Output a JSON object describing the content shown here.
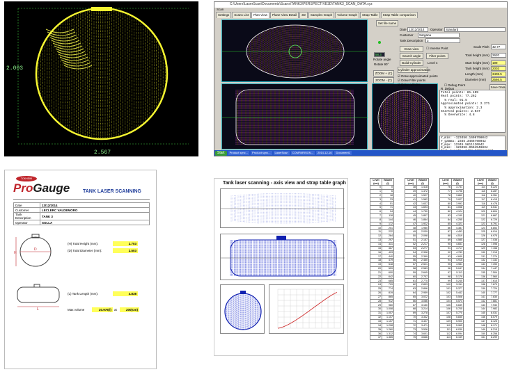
{
  "scan_view": {
    "height_label": "2.003",
    "width_label": "2.567"
  },
  "software": {
    "window_title": "C:\\Users\\LaserScan\\Documents\\Scans\\TANK3\\PERSPECTIVE3D\\TANK3_SCAN_DATA.xyz",
    "menu": "Scan",
    "tabs": [
      "Settings",
      "Scans List",
      "Plan View",
      "Plane View Detail",
      "3D",
      "Samples Graph",
      "Volume Graph",
      "Strap Table",
      "Strap Table comparison"
    ],
    "active_tab_index": 2,
    "buttons": {
      "set_file_name": "Set file name",
      "draw_view": "Draw view",
      "search_angle": "Search angle",
      "filter_points": "Filter points",
      "build_cylinder": "Build Cylinder",
      "cylinder_approximation": "Cylinder approximation",
      "zoom_plus": "ZOOM + (C)",
      "zoom_minus": "ZOOM - (C)",
      "save_data": "Save Data",
      "rotate_angle": "Rotate angle",
      "rotate": "Rotate 90°"
    },
    "fields": {
      "date_label": "Date",
      "date_value": "13/12/2014",
      "operator_label": "Operator",
      "operator_value": "Standard",
      "customer_label": "Customer",
      "customer_value": "Sargana",
      "tank_desc_label": "Tank Description",
      "tank_desc_value": "3",
      "scale_pitch_label": "Scale Pitch",
      "scale_pitch_value": "42.77",
      "total_height_label": "Total height (mm)",
      "total_height_value": "2620",
      "start_height_label": "Start height (mm)",
      "start_height_value": "199",
      "tank_height_label": "Tank height (mm)",
      "tank_height_value": "2003",
      "length_label": "Length (mm)",
      "length_value": "3408.5",
      "diameter_label": "Diameter (mm)",
      "diameter_value": "2566.5",
      "level_label": "Level 4",
      "angle_value": "58.3"
    },
    "checkboxes": {
      "inverse_point": "Inverse Point",
      "draw_approx": "Draw approximated points",
      "draw_filter": "Draw Filter points",
      "draw_cylinder": "Draw cylinder",
      "debug": "Debug Point",
      "debug2": "R_Debug"
    },
    "stats_text": "Total points: 81.409\nReal points: 77.262\n  % real: 91.5\nApproximated points: 2.271\n  % approximation: 2.3\nStarted points: 2.047\n  % Overwrite: 4.8",
    "stats2_text": "Y_min: -123456.1606798042\nY_gamma: 2345.3466798042\nZ_max: 12345.5611120942\nX_min: -123456.9564546834\nTank_length: 3408.5795641334",
    "taskbar": [
      "Start",
      "Product sync...",
      "Product sync...",
      "LaserScan",
      "COMPARISON...",
      "2014-12-16",
      "Document1"
    ]
  },
  "report": {
    "logo_badge": "TOKHEIM",
    "logo_pro": "Pro",
    "logo_gauge": "Gauge",
    "title": "TANK LASER SCANNING",
    "info": [
      {
        "k": "Date",
        "v": "13/12/2014"
      },
      {
        "k": "Customer",
        "v": "LECLERC VALDEMORO"
      },
      {
        "k": "Tank Description",
        "v": "TANK 3"
      },
      {
        "k": "Operator",
        "v": "SOLLA"
      }
    ],
    "meas": [
      {
        "label": "(H) Total Height (mm):",
        "value": "2.703"
      },
      {
        "label": "(D) Total Diameter (mm):",
        "value": "2.503"
      },
      {
        "label": "(L) Tank Length (mm):",
        "value": "4.838"
      }
    ],
    "max_volume_label": "Max volume",
    "max_volume_value": "20.976(l)",
    "max_volume_at": "at",
    "max_volume_mm": "200(cm)",
    "dim_h": "H",
    "dim_d": "D",
    "dim_l": "L"
  },
  "axis_view": {
    "title": "Tank laser scanning - axis view and strap table graph"
  },
  "strap_table": {
    "headers": [
      "Level (cm)",
      "Volume (l)"
    ],
    "columns": [
      [
        [
          "0",
          "0"
        ],
        [
          "1",
          "6"
        ],
        [
          "2",
          "18"
        ],
        [
          "3",
          "33"
        ],
        [
          "4",
          "51"
        ],
        [
          "5",
          "71"
        ],
        [
          "6",
          "94"
        ],
        [
          "7",
          "118"
        ],
        [
          "8",
          "144"
        ],
        [
          "9",
          "172"
        ],
        [
          "10",
          "201"
        ],
        [
          "11",
          "232"
        ],
        [
          "12",
          "264"
        ],
        [
          "13",
          "297"
        ],
        [
          "14",
          "331"
        ],
        [
          "15",
          "367"
        ],
        [
          "16",
          "403"
        ],
        [
          "17",
          "440"
        ],
        [
          "18",
          "479"
        ],
        [
          "19",
          "518"
        ],
        [
          "20",
          "559"
        ],
        [
          "21",
          "600"
        ],
        [
          "22",
          "642"
        ],
        [
          "23",
          "685"
        ],
        [
          "24",
          "729"
        ],
        [
          "25",
          "774"
        ],
        [
          "26",
          "819"
        ],
        [
          "27",
          "865"
        ],
        [
          "28",
          "912"
        ],
        [
          "29",
          "960"
        ],
        [
          "30",
          "1.008"
        ],
        [
          "31",
          "1.057"
        ],
        [
          "32",
          "1.107"
        ],
        [
          "33",
          "1.157"
        ],
        [
          "34",
          "1.208"
        ],
        [
          "35",
          "1.260"
        ],
        [
          "36",
          "1.312"
        ],
        [
          "37",
          "1.365"
        ]
      ],
      [
        [
          "38",
          "1.418"
        ],
        [
          "39",
          "1.472"
        ],
        [
          "40",
          "1.527"
        ],
        [
          "41",
          "1.582"
        ],
        [
          "42",
          "1.637"
        ],
        [
          "43",
          "1.693"
        ],
        [
          "44",
          "1.750"
        ],
        [
          "45",
          "1.807"
        ],
        [
          "46",
          "1.864"
        ],
        [
          "47",
          "1.922"
        ],
        [
          "48",
          "1.980"
        ],
        [
          "49",
          "2.039"
        ],
        [
          "50",
          "2.098"
        ],
        [
          "51",
          "2.157"
        ],
        [
          "52",
          "2.217"
        ],
        [
          "53",
          "2.277"
        ],
        [
          "54",
          "2.338"
        ],
        [
          "55",
          "2.399"
        ],
        [
          "56",
          "2.460"
        ],
        [
          "57",
          "2.521"
        ],
        [
          "58",
          "2.583"
        ],
        [
          "59",
          "2.645"
        ],
        [
          "60",
          "2.707"
        ],
        [
          "61",
          "2.770"
        ],
        [
          "62",
          "2.833"
        ],
        [
          "63",
          "2.896"
        ],
        [
          "64",
          "2.959"
        ],
        [
          "65",
          "3.022"
        ],
        [
          "66",
          "3.086"
        ],
        [
          "67",
          "3.150"
        ],
        [
          "68",
          "3.214"
        ],
        [
          "69",
          "3.278"
        ],
        [
          "70",
          "3.342"
        ],
        [
          "71",
          "3.407"
        ],
        [
          "72",
          "3.471"
        ],
        [
          "73",
          "3.536"
        ],
        [
          "74",
          "3.601"
        ],
        [
          "75",
          "3.666"
        ]
      ],
      [
        [
          "76",
          "3.731"
        ],
        [
          "77",
          "3.796"
        ],
        [
          "78",
          "3.862"
        ],
        [
          "79",
          "3.927"
        ],
        [
          "80",
          "3.993"
        ],
        [
          "81",
          "4.058"
        ],
        [
          "82",
          "4.124"
        ],
        [
          "83",
          "4.190"
        ],
        [
          "84",
          "4.255"
        ],
        [
          "85",
          "4.321"
        ],
        [
          "86",
          "4.387"
        ],
        [
          "87",
          "4.453"
        ],
        [
          "88",
          "4.519"
        ],
        [
          "89",
          "4.585"
        ],
        [
          "90",
          "4.651"
        ],
        [
          "91",
          "4.717"
        ],
        [
          "92",
          "4.783"
        ],
        [
          "93",
          "4.849"
        ],
        [
          "94",
          "4.915"
        ],
        [
          "95",
          "4.981"
        ],
        [
          "96",
          "5.047"
        ],
        [
          "97",
          "5.113"
        ],
        [
          "98",
          "5.179"
        ],
        [
          "99",
          "5.245"
        ],
        [
          "100",
          "5.311"
        ],
        [
          "101",
          "5.377"
        ],
        [
          "102",
          "5.442"
        ],
        [
          "103",
          "5.508"
        ],
        [
          "104",
          "5.574"
        ],
        [
          "105",
          "5.639"
        ],
        [
          "106",
          "5.705"
        ],
        [
          "107",
          "5.770"
        ],
        [
          "108",
          "5.835"
        ],
        [
          "109",
          "5.900"
        ],
        [
          "110",
          "5.965"
        ],
        [
          "111",
          "6.030"
        ],
        [
          "112",
          "6.094"
        ],
        [
          "113",
          "6.159"
        ]
      ],
      [
        [
          "114",
          "6.223"
        ],
        [
          "115",
          "6.287"
        ],
        [
          "116",
          "6.351"
        ],
        [
          "117",
          "6.415"
        ],
        [
          "118",
          "6.478"
        ],
        [
          "119",
          "6.541"
        ],
        [
          "120",
          "6.604"
        ],
        [
          "121",
          "6.667"
        ],
        [
          "122",
          "6.729"
        ],
        [
          "123",
          "6.791"
        ],
        [
          "124",
          "6.853"
        ],
        [
          "125",
          "6.914"
        ],
        [
          "126",
          "6.975"
        ],
        [
          "127",
          "7.036"
        ],
        [
          "128",
          "7.096"
        ],
        [
          "129",
          "7.156"
        ],
        [
          "130",
          "7.215"
        ],
        [
          "131",
          "7.274"
        ],
        [
          "132",
          "7.332"
        ],
        [
          "133",
          "7.390"
        ],
        [
          "134",
          "7.447"
        ],
        [
          "135",
          "7.504"
        ],
        [
          "136",
          "7.560"
        ],
        [
          "137",
          "7.615"
        ],
        [
          "138",
          "7.670"
        ],
        [
          "139",
          "7.724"
        ],
        [
          "140",
          "7.777"
        ],
        [
          "141",
          "7.830"
        ],
        [
          "142",
          "7.881"
        ],
        [
          "143",
          "7.932"
        ],
        [
          "144",
          "7.982"
        ],
        [
          "145",
          "8.031"
        ],
        [
          "146",
          "8.079"
        ],
        [
          "147",
          "8.125"
        ],
        [
          "148",
          "8.171"
        ],
        [
          "149",
          "8.215"
        ],
        [
          "150",
          "8.258"
        ],
        [
          "151",
          "8.299"
        ]
      ]
    ]
  }
}
